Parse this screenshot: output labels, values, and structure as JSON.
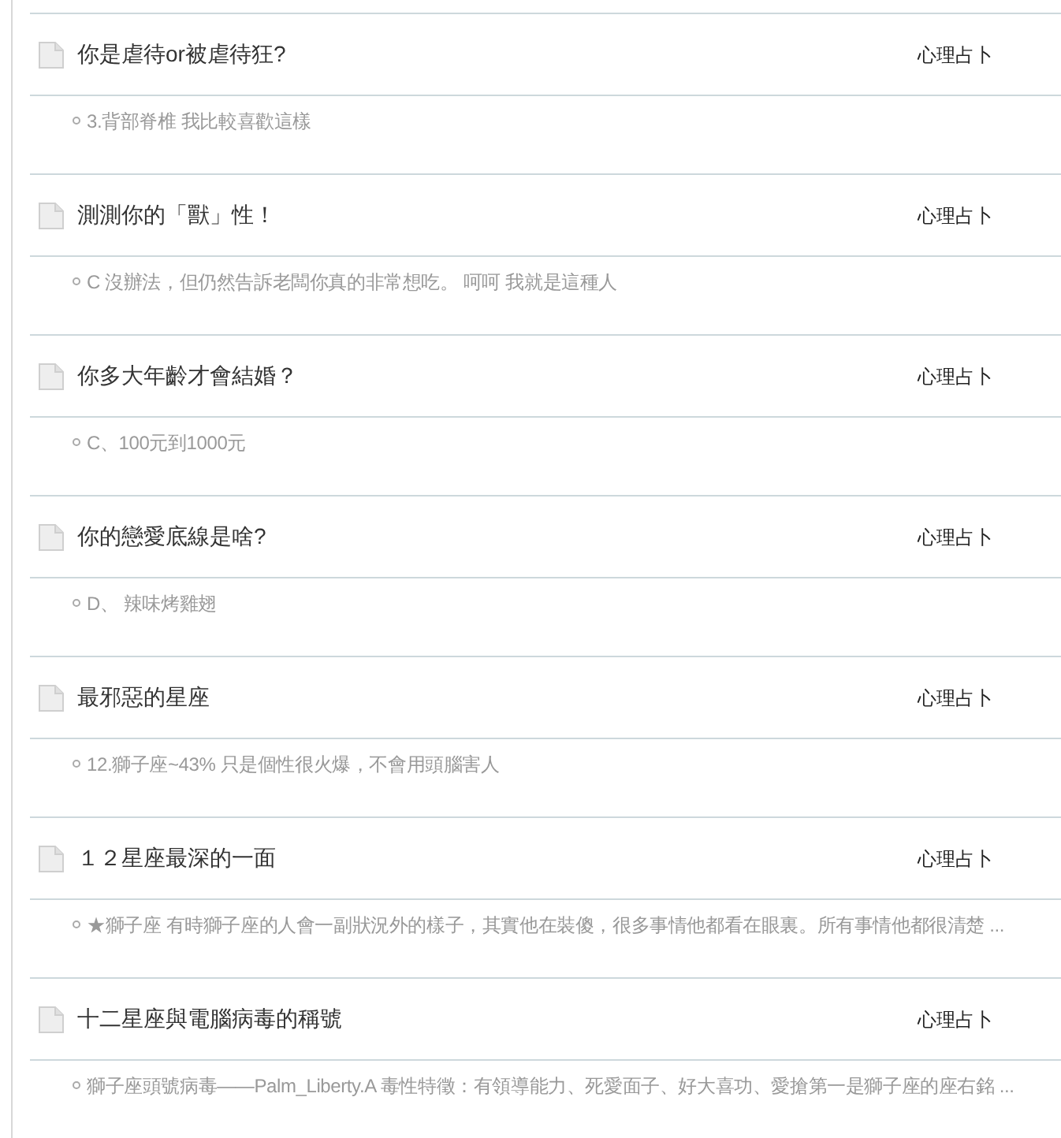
{
  "posts": [
    {
      "title": "你是虐待or被虐待狂?",
      "category": "心理占卜",
      "answer": "3.背部脊椎 我比較喜歡這樣"
    },
    {
      "title": "測測你的「獸」性！",
      "category": "心理占卜",
      "answer": "C 沒辦法，但仍然告訴老闆你真的非常想吃。 呵呵 我就是這種人"
    },
    {
      "title": "你多大年齡才會結婚？",
      "category": "心理占卜",
      "answer": "C、100元到1000元"
    },
    {
      "title": "你的戀愛底線是啥?",
      "category": "心理占卜",
      "answer": "D、 辣味烤雞翅"
    },
    {
      "title": "最邪惡的星座",
      "category": "心理占卜",
      "answer": "12.獅子座~43% 只是個性很火爆，不會用頭腦害人"
    },
    {
      "title": "１２星座最深的一面",
      "category": "心理占卜",
      "answer": "★獅子座 有時獅子座的人會一副狀況外的樣子，其實他在裝傻，很多事情他都看在眼裏。所有事情他都很清楚 ..."
    },
    {
      "title": "十二星座與電腦病毒的稱號",
      "category": "心理占卜",
      "answer": "獅子座頭號病毒——Palm_Liberty.A 毒性特徵：有領導能力、死愛面子、好大喜功、愛搶第一是獅子座的座右銘 ..."
    }
  ]
}
